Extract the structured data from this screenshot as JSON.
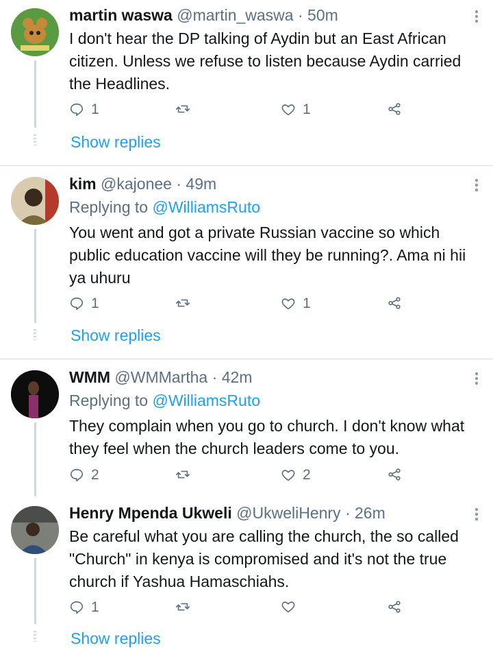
{
  "tweets": [
    {
      "name": "martin waswa",
      "handle": "@martin_waswa",
      "time": "50m",
      "replying_prefix": "",
      "replying_to": "",
      "text": "I don't hear the DP talking of Aydin but an East African citizen. Unless we refuse to listen because Aydin carried the Headlines.",
      "replies": "1",
      "retweets": "",
      "likes": "1",
      "show_replies": "Show replies"
    },
    {
      "name": "kim",
      "handle": "@kajonee",
      "time": "49m",
      "replying_prefix": "Replying to ",
      "replying_to": "@WilliamsRuto",
      "text": "You went and got a private Russian vaccine so which public education vaccine will they be running?. Ama ni hii ya uhuru",
      "replies": "1",
      "retweets": "",
      "likes": "1",
      "show_replies": "Show replies"
    },
    {
      "name": "WMM",
      "handle": "@WMMartha",
      "time": "42m",
      "replying_prefix": "Replying to ",
      "replying_to": "@WilliamsRuto",
      "text": "They complain when you go to church. I don't know what they feel when the church leaders come to you.",
      "replies": "2",
      "retweets": "",
      "likes": "2",
      "show_replies": ""
    },
    {
      "name": "Henry Mpenda Ukweli",
      "handle": "@UkweliHenry",
      "time": "26m",
      "replying_prefix": "",
      "replying_to": "",
      "text": "Be careful what you are calling the church, the so called \"Church\" in kenya is compromised and it's not the true church if Yashua Hamaschiahs.",
      "replies": "1",
      "retweets": "",
      "likes": "",
      "show_replies": "Show replies"
    }
  ],
  "separator": "·",
  "colors": {
    "accent": "#1da1f2",
    "muted": "#5b7083",
    "text": "#14171a",
    "line": "#cfd9de"
  },
  "icons": {
    "reply": "reply-icon",
    "retweet": "retweet-icon",
    "like": "heart-icon",
    "share": "share-icon",
    "more": "more-icon"
  }
}
